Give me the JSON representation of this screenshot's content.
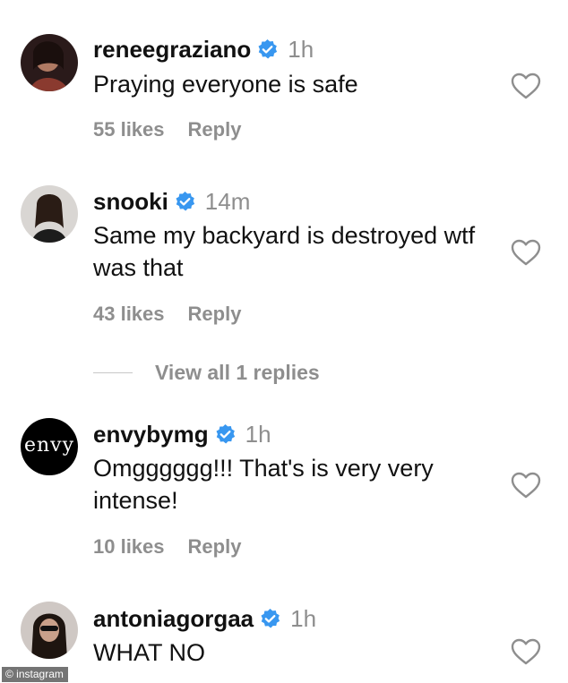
{
  "comments": [
    {
      "username": "reneegraziano",
      "time": "1h",
      "text": "Praying everyone is safe",
      "likes": "55 likes",
      "reply": "Reply"
    },
    {
      "username": "snooki",
      "time": "14m",
      "text": "Same my backyard is destroyed wtf was that",
      "likes": "43 likes",
      "reply": "Reply",
      "view_replies": "View all 1 replies"
    },
    {
      "username": "envybymg",
      "time": "1h",
      "text": "Omgggggg!!! That's is very very intense!",
      "likes": "10 likes",
      "reply": "Reply",
      "avatar_text": "envy"
    },
    {
      "username": "antoniagorgaa",
      "time": "1h",
      "text": "WHAT NO"
    }
  ],
  "watermark": "© instagram",
  "colors": {
    "verified_badge": "#3897f0",
    "secondary_text": "#8e8e8e",
    "primary_text": "#111111"
  },
  "icons": {
    "verified": "verified-badge-icon",
    "like": "heart-outline-icon"
  }
}
